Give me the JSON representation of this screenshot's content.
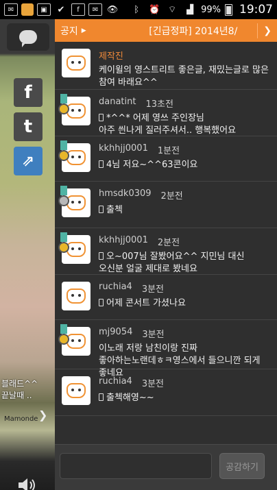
{
  "status_bar": {
    "battery": "99%",
    "time": "19:07"
  },
  "left": {
    "caption": "블래드^^\n끝날때 ..",
    "brand": "Mamonde"
  },
  "notice": {
    "label": "공지",
    "text": "[긴급정파] 2014년8/"
  },
  "messages": [
    {
      "name": "제작진",
      "time": "",
      "text": "케이윌의 영스트리트 좋은글, 재밌는글로 많은 참여 바래요^^",
      "badge": "none",
      "phone": false,
      "height": 70
    },
    {
      "name": "danatint",
      "time": "13초전",
      "text": "*^^* 어제 영쓰 주인장님\n아주 씐나게 질러주셔서.. 행복했어요",
      "badge": "gold",
      "phone": true
    },
    {
      "name": "kkhhjj0001",
      "time": "1분전",
      "text": "4님 저요~^^63콘이요",
      "badge": "gold",
      "phone": true
    },
    {
      "name": "hmsdk0309",
      "time": "2분전",
      "text": "출첵",
      "badge": "silver",
      "phone": true
    },
    {
      "name": "kkhhjj0001",
      "time": "2분전",
      "text": "오~007님  잘봤어요^^  지민님  대신\n오신분 얼굴 제대로 봤네요",
      "badge": "gold",
      "phone": true
    },
    {
      "name": "ruchia4",
      "time": "3분전",
      "text": "어제 콘서트 가셨나요",
      "badge": "none",
      "phone": true
    },
    {
      "name": "mj9054",
      "time": "3분전",
      "text": "이노래 저랑 남친이랑 진짜\n좋아하는노랜데ㅎㅋ영스에서 들으니깐 되게\n좋네요",
      "badge": "gold",
      "phone": false
    },
    {
      "name": "ruchia4",
      "time": "3분전",
      "text": "출첵해영~~",
      "badge": "none",
      "phone": true
    }
  ],
  "input": {
    "placeholder": "",
    "send_label": "공감하기"
  }
}
